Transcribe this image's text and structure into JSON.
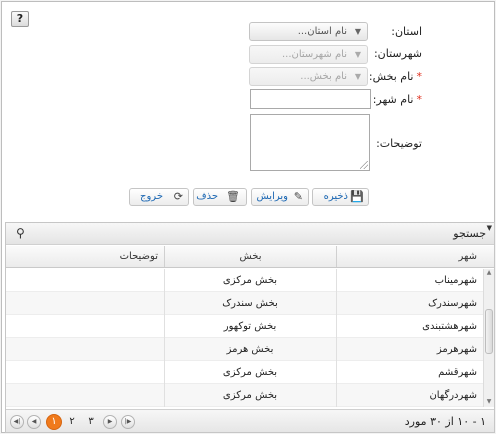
{
  "help": {
    "label": "?"
  },
  "form": {
    "province": {
      "label": "استان:",
      "placeholder": "نام استان..."
    },
    "county": {
      "label": "شهرستان:",
      "placeholder": "نام شهرستان..."
    },
    "district": {
      "label": "نام بخش:",
      "placeholder": "نام بخش..."
    },
    "city": {
      "label": "نام شهر:",
      "value": ""
    },
    "description": {
      "label": "توضیحات:",
      "value": ""
    },
    "required_mark": "*",
    "arrow": "▼"
  },
  "actions": {
    "save": "ذخیره",
    "edit": "ویرایش",
    "delete": "حذف",
    "exit": "خروج"
  },
  "grid": {
    "search_label": "جستجو",
    "columns": [
      "شهر",
      "بخش",
      "توضیحات"
    ],
    "rows": [
      {
        "city": "شهرمیناب",
        "district": "بخش مرکزی",
        "description": ""
      },
      {
        "city": "شهرسندرک",
        "district": "بخش سندرک",
        "description": ""
      },
      {
        "city": "شهرهشتبندی",
        "district": "بخش توکهور",
        "description": ""
      },
      {
        "city": "شهرهرمز",
        "district": "بخش هرمز",
        "description": ""
      },
      {
        "city": "شهرقشم",
        "district": "بخش مرکزی",
        "description": ""
      },
      {
        "city": "شهردرگهان",
        "district": "بخش مرکزی",
        "description": ""
      }
    ]
  },
  "pager": {
    "pages": [
      "۱",
      "۲",
      "۳"
    ],
    "current_page": "۱",
    "info": "۱ - ۱۰ از ۳۰ مورد"
  },
  "colors": {
    "accent": "#f07a1c",
    "link": "#1b67b3",
    "required": "#e0301e"
  }
}
